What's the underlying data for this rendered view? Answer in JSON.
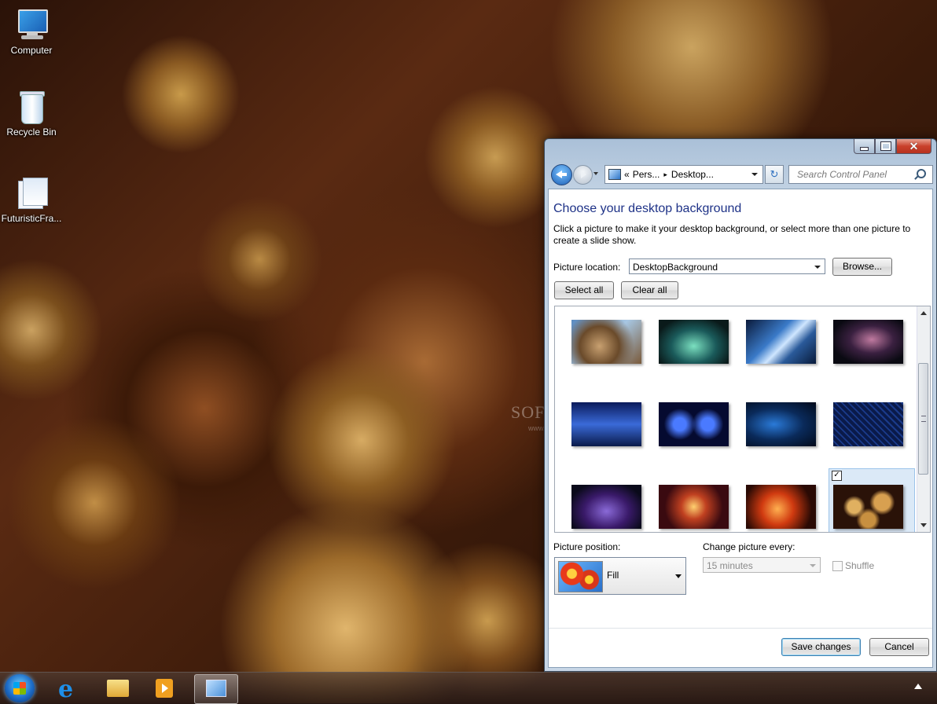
{
  "desktop": {
    "icons": [
      {
        "label": "Computer"
      },
      {
        "label": "Recycle Bin"
      },
      {
        "label": "FuturisticFra..."
      }
    ],
    "watermark": "SOFTPEDIA",
    "watermark_url": "www.softpedia.com"
  },
  "window": {
    "controls": {
      "minimize": "minimize",
      "maximize": "maximize",
      "close": "✕"
    },
    "address": {
      "chevron": "«",
      "segments": [
        "Pers...",
        "Desktop..."
      ],
      "separator": "▸"
    },
    "refresh_glyph": "↻",
    "search": {
      "placeholder": "Search Control Panel"
    },
    "title": "Choose your desktop background",
    "description": "Click a picture to make it your desktop background, or select more than one picture to create a slide show.",
    "picture_location": {
      "label": "Picture location:",
      "value": "DesktopBackground",
      "browse": "Browse..."
    },
    "select_all": "Select all",
    "clear_all": "Clear all",
    "gallery": {
      "thumbnails": [
        {
          "name": "fractal-1",
          "selected": false
        },
        {
          "name": "fractal-2",
          "selected": false
        },
        {
          "name": "fractal-3",
          "selected": false
        },
        {
          "name": "fractal-4",
          "selected": false
        },
        {
          "name": "fractal-5",
          "selected": false
        },
        {
          "name": "fractal-6",
          "selected": false
        },
        {
          "name": "fractal-7",
          "selected": false
        },
        {
          "name": "fractal-8",
          "selected": false
        },
        {
          "name": "fractal-9",
          "selected": false
        },
        {
          "name": "fractal-10",
          "selected": false
        },
        {
          "name": "fractal-11",
          "selected": false
        },
        {
          "name": "fractal-12",
          "selected": true
        }
      ],
      "checkmark": "✓"
    },
    "picture_position": {
      "label": "Picture position:",
      "value": "Fill"
    },
    "change_picture": {
      "label": "Change picture every:",
      "value": "15 minutes"
    },
    "shuffle": {
      "label": "Shuffle"
    },
    "save": "Save changes",
    "cancel": "Cancel"
  },
  "taskbar": {
    "items": [
      "start",
      "internet-explorer",
      "windows-explorer",
      "media-center",
      "control-panel"
    ]
  },
  "colors": {
    "title_blue": "#1e3287",
    "close_red": "#c9412c"
  }
}
